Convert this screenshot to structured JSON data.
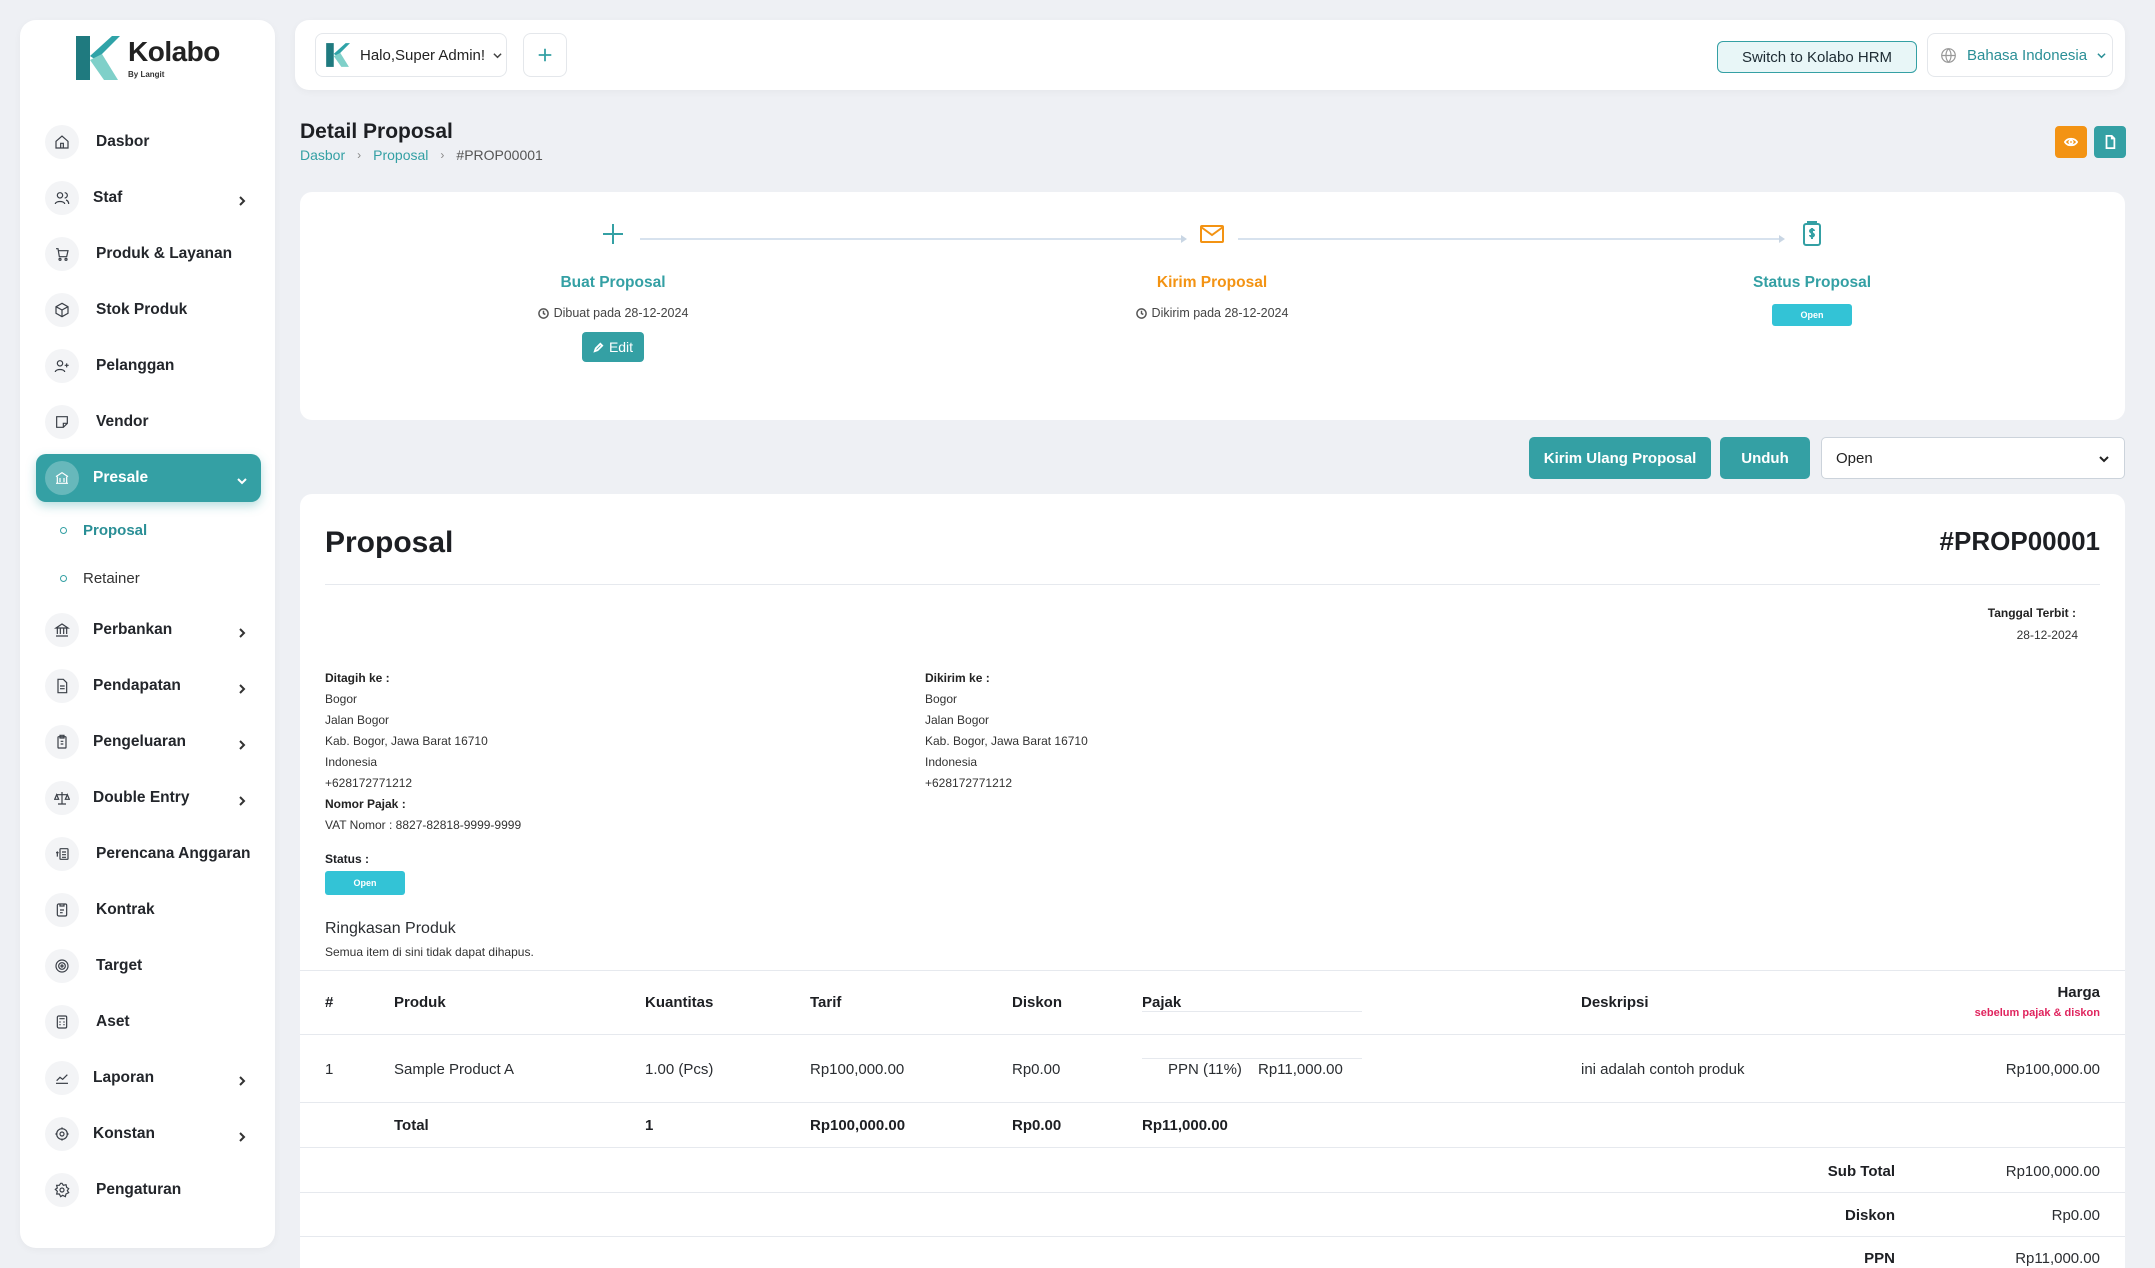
{
  "brand": {
    "name": "Kolabo",
    "sub": "By Langit"
  },
  "sidebar": {
    "items": [
      {
        "label": "Dasbor"
      },
      {
        "label": "Staf"
      },
      {
        "label": "Produk & Layanan"
      },
      {
        "label": "Stok Produk"
      },
      {
        "label": "Pelanggan"
      },
      {
        "label": "Vendor"
      },
      {
        "label": "Presale"
      },
      {
        "label": "Perbankan"
      },
      {
        "label": "Pendapatan"
      },
      {
        "label": "Pengeluaran"
      },
      {
        "label": "Double Entry"
      },
      {
        "label": "Perencana Anggaran"
      },
      {
        "label": "Kontrak"
      },
      {
        "label": "Target"
      },
      {
        "label": "Aset"
      },
      {
        "label": "Laporan"
      },
      {
        "label": "Konstan"
      },
      {
        "label": "Pengaturan"
      }
    ],
    "subitems": [
      {
        "label": "Proposal"
      },
      {
        "label": "Retainer"
      }
    ]
  },
  "topbar": {
    "greeting": "Halo,Super Admin!",
    "switch_label": "Switch to Kolabo HRM",
    "language": "Bahasa Indonesia"
  },
  "page": {
    "title": "Detail Proposal",
    "breadcrumb": [
      "Dasbor",
      "Proposal",
      "#PROP00001"
    ]
  },
  "steps": [
    {
      "title": "Buat Proposal",
      "sub": "Dibuat pada 28-12-2024",
      "button": "Edit",
      "color": "#34a0a4"
    },
    {
      "title": "Kirim Proposal",
      "sub": "Dikirim pada 28-12-2024",
      "color": "#f39313"
    },
    {
      "title": "Status Proposal",
      "chip": "Open",
      "color": "#34a0a4"
    }
  ],
  "actions": {
    "resend": "Kirim Ulang Proposal",
    "download": "Unduh",
    "status_select": "Open"
  },
  "proposal": {
    "title": "Proposal",
    "number": "#PROP00001",
    "issue_label": "Tanggal Terbit :",
    "issue_date": "28-12-2024",
    "billed": {
      "label": "Ditagih ke :",
      "lines": [
        "Bogor",
        "Jalan Bogor",
        "Kab. Bogor, Jawa Barat 16710",
        "Indonesia",
        "+628172771212"
      ],
      "tax_label": "Nomor Pajak :",
      "tax_value": "VAT Nomor : 8827-82818-9999-9999"
    },
    "shipped": {
      "label": "Dikirim ke :",
      "lines": [
        "Bogor",
        "Jalan Bogor",
        "Kab. Bogor, Jawa Barat 16710",
        "Indonesia",
        "+628172771212"
      ]
    },
    "status_label": "Status :",
    "status_value": "Open",
    "summary_title": "Ringkasan Produk",
    "summary_sub": "Semua item di sini tidak dapat dihapus.",
    "table": {
      "headers": [
        "#",
        "Produk",
        "Kuantitas",
        "Tarif",
        "Diskon",
        "Pajak",
        "Deskripsi",
        "Harga"
      ],
      "price_note": "sebelum pajak & diskon",
      "rows": [
        {
          "no": "1",
          "product": "Sample Product A",
          "qty": "1.00 (Pcs)",
          "rate": "Rp100,000.00",
          "discount": "Rp0.00",
          "tax_name": "PPN (11%)",
          "tax_amount": "Rp11,000.00",
          "desc": "ini adalah contoh produk",
          "price": "Rp100,000.00"
        }
      ],
      "total": {
        "label": "Total",
        "qty": "1",
        "rate": "Rp100,000.00",
        "discount": "Rp0.00",
        "tax": "Rp11,000.00"
      }
    },
    "totals": [
      {
        "label": "Sub Total",
        "value": "Rp100,000.00"
      },
      {
        "label": "Diskon",
        "value": "Rp0.00"
      },
      {
        "label": "PPN",
        "value": "Rp11,000.00"
      }
    ]
  }
}
